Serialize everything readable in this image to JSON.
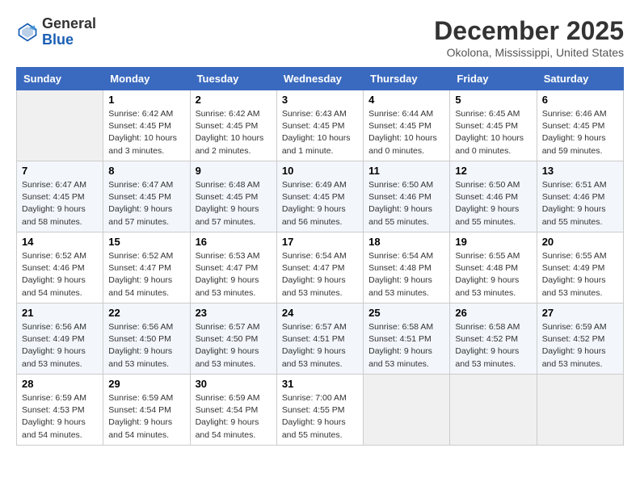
{
  "header": {
    "logo_line1": "General",
    "logo_line2": "Blue",
    "title": "December 2025",
    "subtitle": "Okolona, Mississippi, United States"
  },
  "weekdays": [
    "Sunday",
    "Monday",
    "Tuesday",
    "Wednesday",
    "Thursday",
    "Friday",
    "Saturday"
  ],
  "weeks": [
    [
      {
        "day": "",
        "empty": true
      },
      {
        "day": "1",
        "sunrise": "6:42 AM",
        "sunset": "4:45 PM",
        "daylight": "10 hours and 3 minutes."
      },
      {
        "day": "2",
        "sunrise": "6:42 AM",
        "sunset": "4:45 PM",
        "daylight": "10 hours and 2 minutes."
      },
      {
        "day": "3",
        "sunrise": "6:43 AM",
        "sunset": "4:45 PM",
        "daylight": "10 hours and 1 minute."
      },
      {
        "day": "4",
        "sunrise": "6:44 AM",
        "sunset": "4:45 PM",
        "daylight": "10 hours and 0 minutes."
      },
      {
        "day": "5",
        "sunrise": "6:45 AM",
        "sunset": "4:45 PM",
        "daylight": "10 hours and 0 minutes."
      },
      {
        "day": "6",
        "sunrise": "6:46 AM",
        "sunset": "4:45 PM",
        "daylight": "9 hours and 59 minutes."
      }
    ],
    [
      {
        "day": "7",
        "sunrise": "6:47 AM",
        "sunset": "4:45 PM",
        "daylight": "9 hours and 58 minutes."
      },
      {
        "day": "8",
        "sunrise": "6:47 AM",
        "sunset": "4:45 PM",
        "daylight": "9 hours and 57 minutes."
      },
      {
        "day": "9",
        "sunrise": "6:48 AM",
        "sunset": "4:45 PM",
        "daylight": "9 hours and 57 minutes."
      },
      {
        "day": "10",
        "sunrise": "6:49 AM",
        "sunset": "4:45 PM",
        "daylight": "9 hours and 56 minutes."
      },
      {
        "day": "11",
        "sunrise": "6:50 AM",
        "sunset": "4:46 PM",
        "daylight": "9 hours and 55 minutes."
      },
      {
        "day": "12",
        "sunrise": "6:50 AM",
        "sunset": "4:46 PM",
        "daylight": "9 hours and 55 minutes."
      },
      {
        "day": "13",
        "sunrise": "6:51 AM",
        "sunset": "4:46 PM",
        "daylight": "9 hours and 55 minutes."
      }
    ],
    [
      {
        "day": "14",
        "sunrise": "6:52 AM",
        "sunset": "4:46 PM",
        "daylight": "9 hours and 54 minutes."
      },
      {
        "day": "15",
        "sunrise": "6:52 AM",
        "sunset": "4:47 PM",
        "daylight": "9 hours and 54 minutes."
      },
      {
        "day": "16",
        "sunrise": "6:53 AM",
        "sunset": "4:47 PM",
        "daylight": "9 hours and 53 minutes."
      },
      {
        "day": "17",
        "sunrise": "6:54 AM",
        "sunset": "4:47 PM",
        "daylight": "9 hours and 53 minutes."
      },
      {
        "day": "18",
        "sunrise": "6:54 AM",
        "sunset": "4:48 PM",
        "daylight": "9 hours and 53 minutes."
      },
      {
        "day": "19",
        "sunrise": "6:55 AM",
        "sunset": "4:48 PM",
        "daylight": "9 hours and 53 minutes."
      },
      {
        "day": "20",
        "sunrise": "6:55 AM",
        "sunset": "4:49 PM",
        "daylight": "9 hours and 53 minutes."
      }
    ],
    [
      {
        "day": "21",
        "sunrise": "6:56 AM",
        "sunset": "4:49 PM",
        "daylight": "9 hours and 53 minutes."
      },
      {
        "day": "22",
        "sunrise": "6:56 AM",
        "sunset": "4:50 PM",
        "daylight": "9 hours and 53 minutes."
      },
      {
        "day": "23",
        "sunrise": "6:57 AM",
        "sunset": "4:50 PM",
        "daylight": "9 hours and 53 minutes."
      },
      {
        "day": "24",
        "sunrise": "6:57 AM",
        "sunset": "4:51 PM",
        "daylight": "9 hours and 53 minutes."
      },
      {
        "day": "25",
        "sunrise": "6:58 AM",
        "sunset": "4:51 PM",
        "daylight": "9 hours and 53 minutes."
      },
      {
        "day": "26",
        "sunrise": "6:58 AM",
        "sunset": "4:52 PM",
        "daylight": "9 hours and 53 minutes."
      },
      {
        "day": "27",
        "sunrise": "6:59 AM",
        "sunset": "4:52 PM",
        "daylight": "9 hours and 53 minutes."
      }
    ],
    [
      {
        "day": "28",
        "sunrise": "6:59 AM",
        "sunset": "4:53 PM",
        "daylight": "9 hours and 54 minutes."
      },
      {
        "day": "29",
        "sunrise": "6:59 AM",
        "sunset": "4:54 PM",
        "daylight": "9 hours and 54 minutes."
      },
      {
        "day": "30",
        "sunrise": "6:59 AM",
        "sunset": "4:54 PM",
        "daylight": "9 hours and 54 minutes."
      },
      {
        "day": "31",
        "sunrise": "7:00 AM",
        "sunset": "4:55 PM",
        "daylight": "9 hours and 55 minutes."
      },
      {
        "day": "",
        "empty": true
      },
      {
        "day": "",
        "empty": true
      },
      {
        "day": "",
        "empty": true
      }
    ]
  ]
}
